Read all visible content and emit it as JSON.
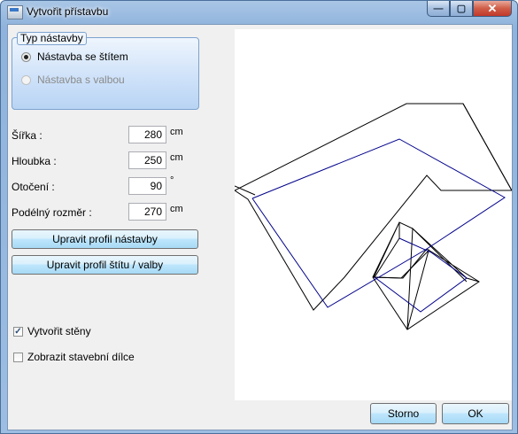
{
  "window": {
    "title": "Vytvořit přístavbu",
    "minimize_glyph": "—",
    "maximize_glyph": "▢",
    "close_glyph": "✕"
  },
  "roof_type": {
    "legend": "Typ nástavby",
    "options": [
      {
        "label": "Nástavba se štítem",
        "selected": true,
        "enabled": true
      },
      {
        "label": "Nástavba s valbou",
        "selected": false,
        "enabled": false
      }
    ]
  },
  "fields": {
    "width": {
      "label": "Šířka :",
      "value": "280",
      "unit": "cm"
    },
    "depth": {
      "label": "Hloubka :",
      "value": "250",
      "unit": "cm"
    },
    "rotation": {
      "label": "Otočení :",
      "value": "90",
      "unit": "°"
    },
    "length": {
      "label": "Podélný rozměr :",
      "value": "270",
      "unit": "cm"
    }
  },
  "buttons": {
    "edit_profile": "Upravit profil nástavby",
    "edit_gable": "Upravit profil štítu / valby",
    "cancel": "Storno",
    "ok": "OK"
  },
  "checkboxes": {
    "create_walls": {
      "label": "Vytvořit stěny",
      "checked": true
    },
    "show_parts": {
      "label": "Zobrazit stavební dílce",
      "checked": false
    }
  },
  "colors": {
    "outline": "#000000",
    "highlight": "#00008b"
  }
}
